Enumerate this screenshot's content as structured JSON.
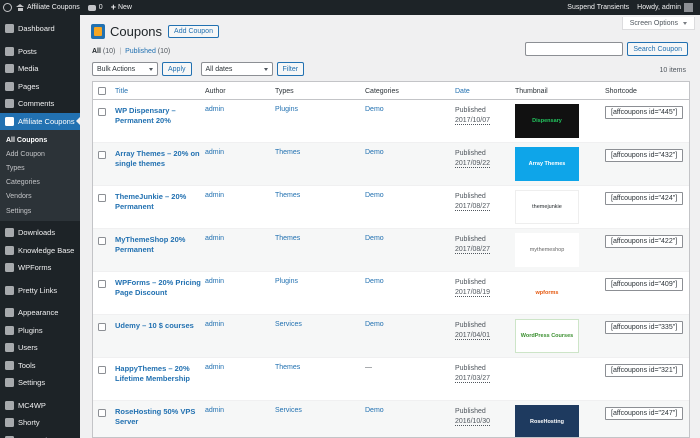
{
  "adminbar": {
    "site_name": "Affiliate Coupons",
    "comments_count": "0",
    "new_label": "New",
    "suspend": "Suspend Transients",
    "howdy": "Howdy, admin"
  },
  "sidebar": {
    "items": [
      {
        "label": "Dashboard",
        "icon": "dashboard-icon"
      },
      {
        "label": "Posts",
        "icon": "pin-icon"
      },
      {
        "label": "Media",
        "icon": "media-icon"
      },
      {
        "label": "Pages",
        "icon": "page-icon"
      },
      {
        "label": "Comments",
        "icon": "comment-icon"
      },
      {
        "label": "Affiliate Coupons",
        "icon": "coupon-icon"
      }
    ],
    "submenu": [
      "All Coupons",
      "Add Coupon",
      "Types",
      "Categories",
      "Vendors",
      "Settings"
    ],
    "items_after": [
      {
        "label": "Downloads",
        "icon": "download-icon"
      },
      {
        "label": "Knowledge Base",
        "icon": "book-icon"
      },
      {
        "label": "WPForms",
        "icon": "form-icon"
      },
      {
        "label": "Pretty Links",
        "icon": "link-icon"
      },
      {
        "label": "Appearance",
        "icon": "brush-icon"
      },
      {
        "label": "Plugins",
        "icon": "plugin-icon"
      },
      {
        "label": "Users",
        "icon": "user-icon"
      },
      {
        "label": "Tools",
        "icon": "wrench-icon"
      },
      {
        "label": "Settings",
        "icon": "settings-icon"
      },
      {
        "label": "MC4WP",
        "icon": "mail-icon"
      },
      {
        "label": "Shorty",
        "icon": "shorty-icon"
      },
      {
        "label": "WP Rocket",
        "icon": "rocket-icon"
      }
    ]
  },
  "header": {
    "screen_options": "Screen Options",
    "title": "Coupons",
    "add_button": "Add Coupon"
  },
  "views": {
    "all": "All",
    "all_count": "(10)",
    "sep": "|",
    "published": "Published",
    "published_count": "(10)"
  },
  "search": {
    "button": "Search Coupon",
    "value": ""
  },
  "tablenav": {
    "bulk_actions": "Bulk Actions",
    "apply": "Apply",
    "all_dates": "All dates",
    "filter": "Filter",
    "items": "10 items"
  },
  "columns": {
    "title": "Title",
    "author": "Author",
    "types": "Types",
    "categories": "Categories",
    "date": "Date",
    "thumbnail": "Thumbnail",
    "shortcode": "Shortcode"
  },
  "rows": [
    {
      "title": "WP Dispensary – Permanent 20%",
      "author": "admin",
      "type": "Plugins",
      "category": "Demo",
      "status": "Published",
      "date": "2017/10/07",
      "thumb": "Dispensary",
      "shortcode": "[affcoupons id=\"445\"]"
    },
    {
      "title": "Array Themes – 20% on single themes",
      "author": "admin",
      "type": "Themes",
      "category": "Demo",
      "status": "Published",
      "date": "2017/09/22",
      "thumb": "Array Themes",
      "shortcode": "[affcoupons id=\"432\"]"
    },
    {
      "title": "ThemeJunkie – 20% Permanent",
      "author": "admin",
      "type": "Themes",
      "category": "Demo",
      "status": "Published",
      "date": "2017/08/27",
      "thumb": "themejunkie",
      "shortcode": "[affcoupons id=\"424\"]"
    },
    {
      "title": "MyThemeShop 20% Permanent",
      "author": "admin",
      "type": "Themes",
      "category": "Demo",
      "status": "Published",
      "date": "2017/08/27",
      "thumb": "mythemeshop",
      "shortcode": "[affcoupons id=\"422\"]"
    },
    {
      "title": "WPForms – 20% Pricing Page Discount",
      "author": "admin",
      "type": "Plugins",
      "category": "Demo",
      "status": "Published",
      "date": "2017/08/19",
      "thumb": "wpforms",
      "shortcode": "[affcoupons id=\"409\"]"
    },
    {
      "title": "Udemy – 10 $ courses",
      "author": "admin",
      "type": "Services",
      "category": "Demo",
      "status": "Published",
      "date": "2017/04/01",
      "thumb": "WordPress Courses",
      "shortcode": "[affcoupons id=\"335\"]"
    },
    {
      "title": "HappyThemes – 20% Lifetime Membership",
      "author": "admin",
      "type": "Themes",
      "category": "—",
      "status": "Published",
      "date": "2017/03/27",
      "thumb": "",
      "shortcode": "[affcoupons id=\"321\"]"
    },
    {
      "title": "RoseHosting 50% VPS Server",
      "author": "admin",
      "type": "Services",
      "category": "Demo",
      "status": "Published",
      "date": "2016/10/30",
      "thumb": "RoseHosting",
      "shortcode": "[affcoupons id=\"247\"]"
    }
  ]
}
